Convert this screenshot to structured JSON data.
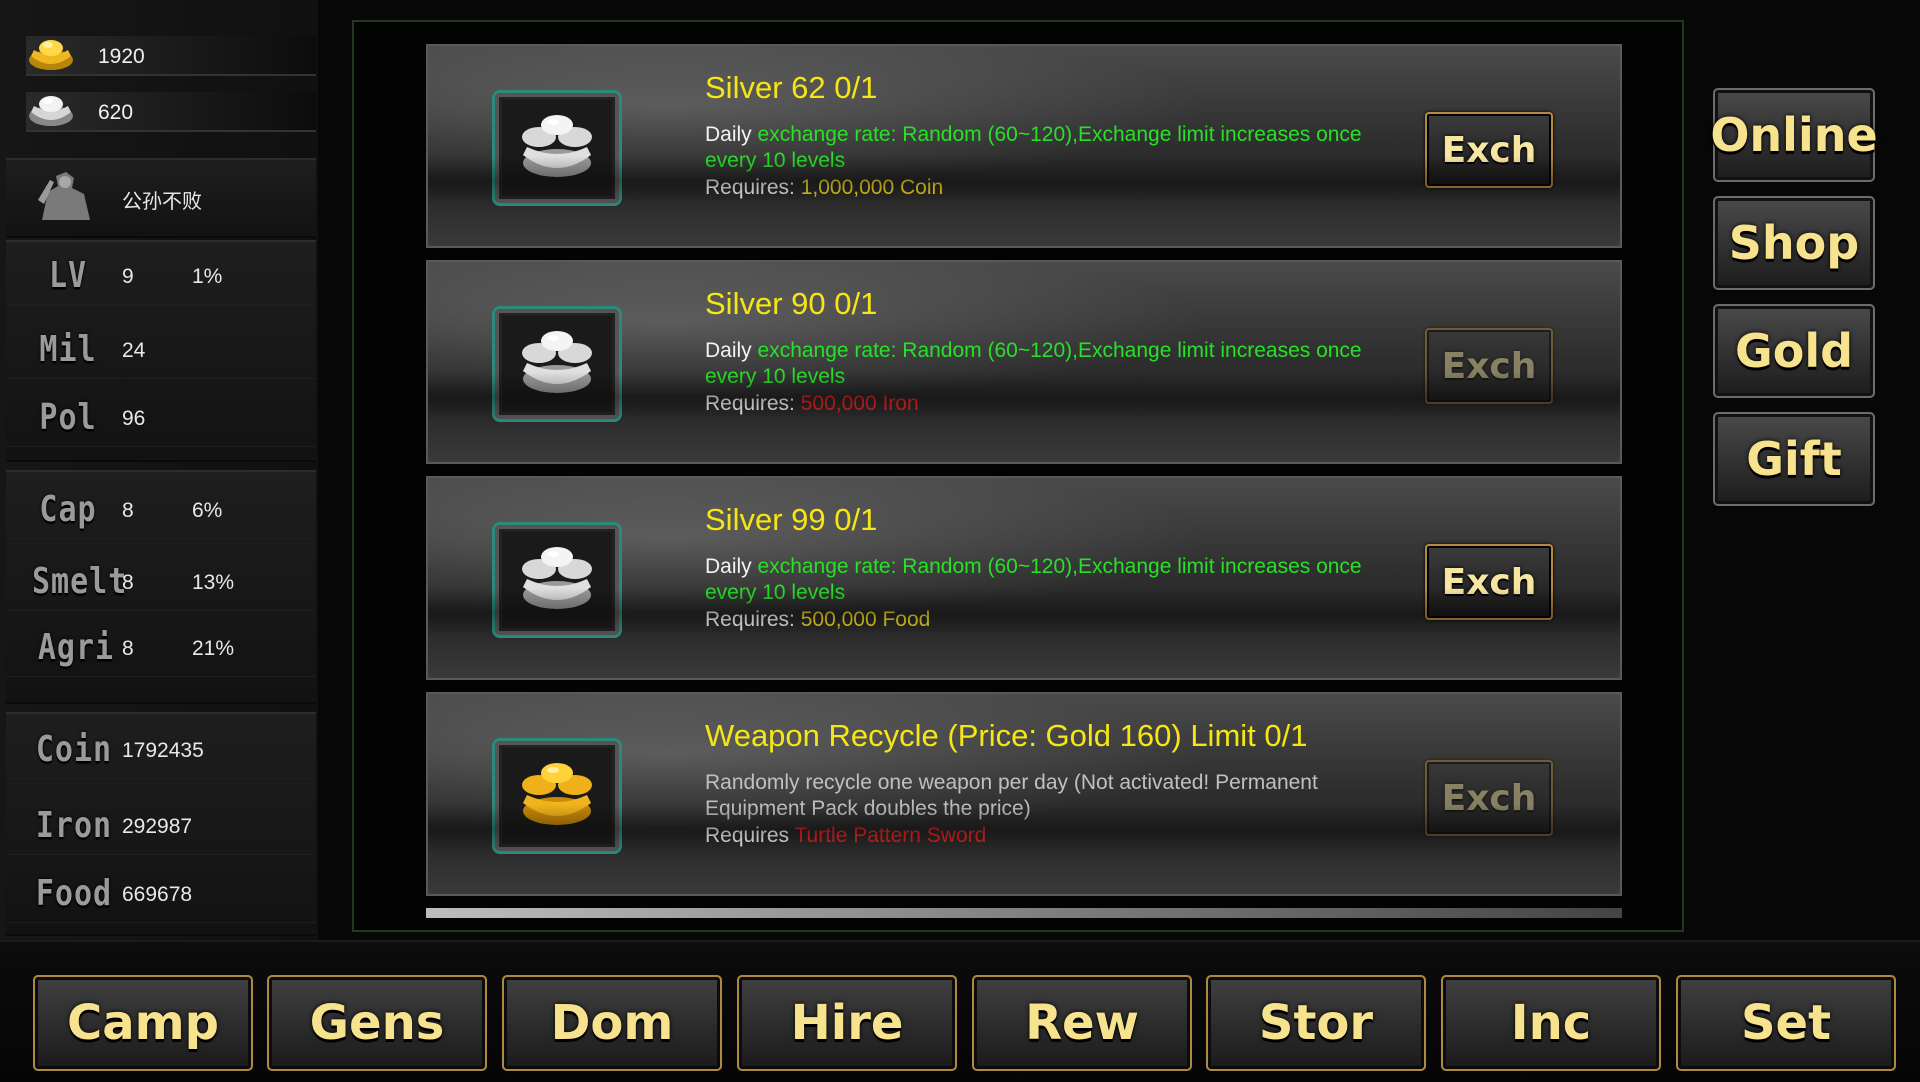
{
  "currencies": {
    "gold": {
      "icon": "gold-ingot-icon",
      "value": "1920"
    },
    "silver": {
      "icon": "silver-ingot-icon",
      "value": "620"
    }
  },
  "player": {
    "icon": "general-portrait-icon",
    "name": "公孙不败"
  },
  "stats": {
    "lv": {
      "label": "LV",
      "value": "9",
      "pct": "1%"
    },
    "mil": {
      "label": "Mil",
      "value": "24"
    },
    "pol": {
      "label": "Pol",
      "value": "96"
    },
    "cap": {
      "label": "Cap",
      "value": "8",
      "pct": "6%"
    },
    "smelt": {
      "label": "Smelt",
      "value": "8",
      "pct": "13%"
    },
    "agri": {
      "label": "Agri",
      "value": "8",
      "pct": "21%"
    }
  },
  "resources": {
    "coin": {
      "label": "Coin",
      "value": "1792435"
    },
    "iron": {
      "label": "Iron",
      "value": "292987"
    },
    "food": {
      "label": "Food",
      "value": "669678"
    }
  },
  "exchange_items": [
    {
      "title": "Silver 62 0/1",
      "desc_prefix": "Daily ",
      "desc_main": "exchange rate: Random (60~120),Exchange limit increases once every 10 levels",
      "req_label": "Requires: ",
      "req_value": "1,000,000 Coin",
      "req_color": "yellow",
      "button": "Exch",
      "enabled": true,
      "icon": "silver-ingots-icon"
    },
    {
      "title": "Silver 90 0/1",
      "desc_prefix": "Daily ",
      "desc_main": "exchange rate: Random (60~120),Exchange limit increases once every 10 levels",
      "req_label": "Requires: ",
      "req_value": "500,000 Iron",
      "req_color": "red",
      "button": "Exch",
      "enabled": false,
      "icon": "silver-ingots-icon"
    },
    {
      "title": "Silver 99 0/1",
      "desc_prefix": "Daily ",
      "desc_main": "exchange rate: Random (60~120),Exchange limit increases once every 10 levels",
      "req_label": "Requires: ",
      "req_value": "500,000 Food",
      "req_color": "yellow",
      "button": "Exch",
      "enabled": true,
      "icon": "silver-ingots-icon"
    },
    {
      "title": "Weapon Recycle (Price: Gold 160) Limit 0/1",
      "desc_text": "Randomly recycle one weapon per day (Not activated! Permanent Equipment Pack doubles the price)",
      "req_label": "Requires ",
      "req_value": "Turtle Pattern Sword",
      "req_color": "red",
      "button": "Exch",
      "enabled": false,
      "icon": "gold-ingots-icon"
    }
  ],
  "side_menu": [
    "Online",
    "Shop",
    "Gold",
    "Gift"
  ],
  "bottom_nav": [
    "Camp",
    "Gens",
    "Dom",
    "Hire",
    "Rew",
    "Stor",
    "Inc",
    "Set"
  ],
  "colors": {
    "title_yellow": "#f5e614",
    "green_text": "#28e028",
    "red_text": "#e42222",
    "button_gold": "#f7e28e"
  }
}
